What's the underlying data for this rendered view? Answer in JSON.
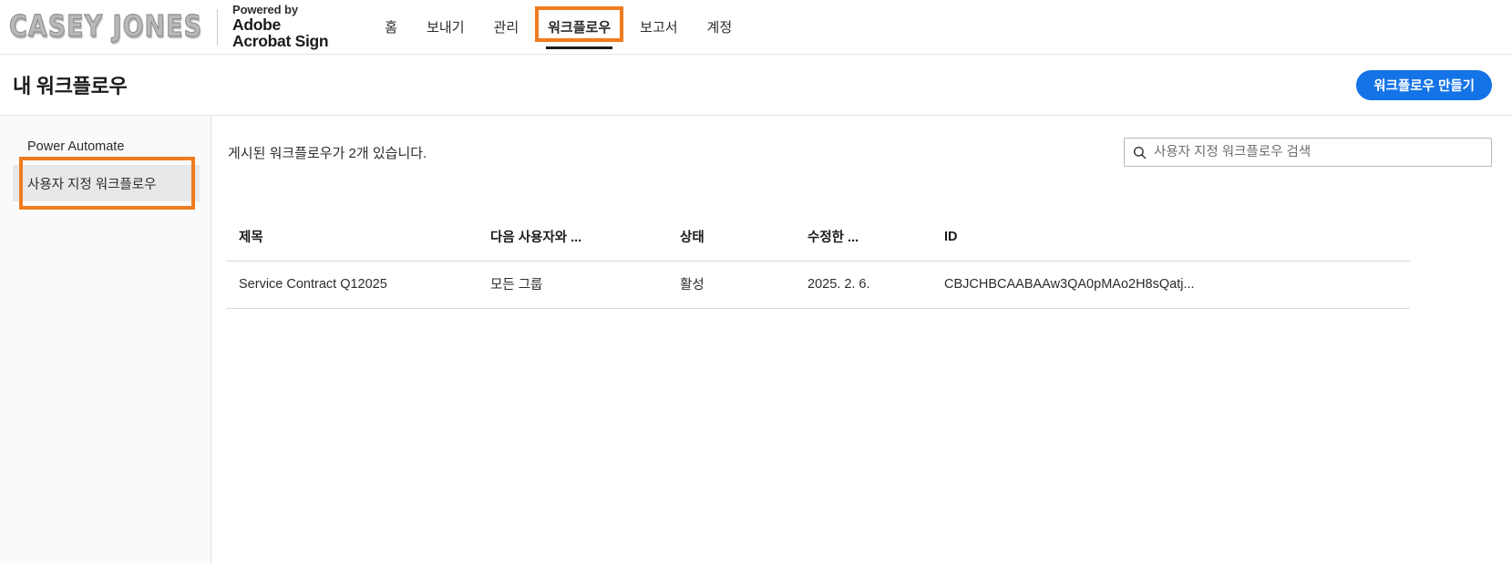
{
  "header": {
    "logo_text": "CASEY JONES",
    "powered_by": "Powered by",
    "adobe_name": "Adobe",
    "adobe_product": "Acrobat Sign",
    "nav": [
      {
        "label": "홈",
        "active": false,
        "highlighted": false
      },
      {
        "label": "보내기",
        "active": false,
        "highlighted": false
      },
      {
        "label": "관리",
        "active": false,
        "highlighted": false
      },
      {
        "label": "워크플로우",
        "active": true,
        "highlighted": true
      },
      {
        "label": "보고서",
        "active": false,
        "highlighted": false
      },
      {
        "label": "계정",
        "active": false,
        "highlighted": false
      }
    ]
  },
  "page": {
    "title": "내 워크플로우",
    "create_button": "워크플로우 만들기"
  },
  "sidebar": {
    "items": [
      {
        "label": "Power Automate",
        "selected": false,
        "highlighted": false
      },
      {
        "label": "사용자 지정 워크플로우",
        "selected": true,
        "highlighted": true
      }
    ]
  },
  "main": {
    "published_count_text": "게시된 워크플로우가 2개 있습니다.",
    "search_placeholder": "사용자 지정 워크플로우 검색",
    "search_value": "",
    "search_icon": "search-icon"
  },
  "table": {
    "columns": [
      {
        "key": "title",
        "label": "제목"
      },
      {
        "key": "shared",
        "label": "다음 사용자와 ..."
      },
      {
        "key": "status",
        "label": "상태"
      },
      {
        "key": "modified",
        "label": "수정한 ..."
      },
      {
        "key": "id",
        "label": "ID"
      }
    ],
    "rows": [
      {
        "title": "Service Contract Q12025",
        "shared": "모든 그룹",
        "status": "활성",
        "modified": "2025. 2. 6.",
        "id": "CBJCHBCAABAAw3QA0pMAo2H8sQatj..."
      }
    ]
  },
  "colors": {
    "accent_blue": "#1473e6",
    "highlight_orange": "#f07c1f",
    "selected_grey": "#e8e8e8",
    "sidebar_bg": "#fafafa",
    "text_primary": "#1b1b1b"
  }
}
